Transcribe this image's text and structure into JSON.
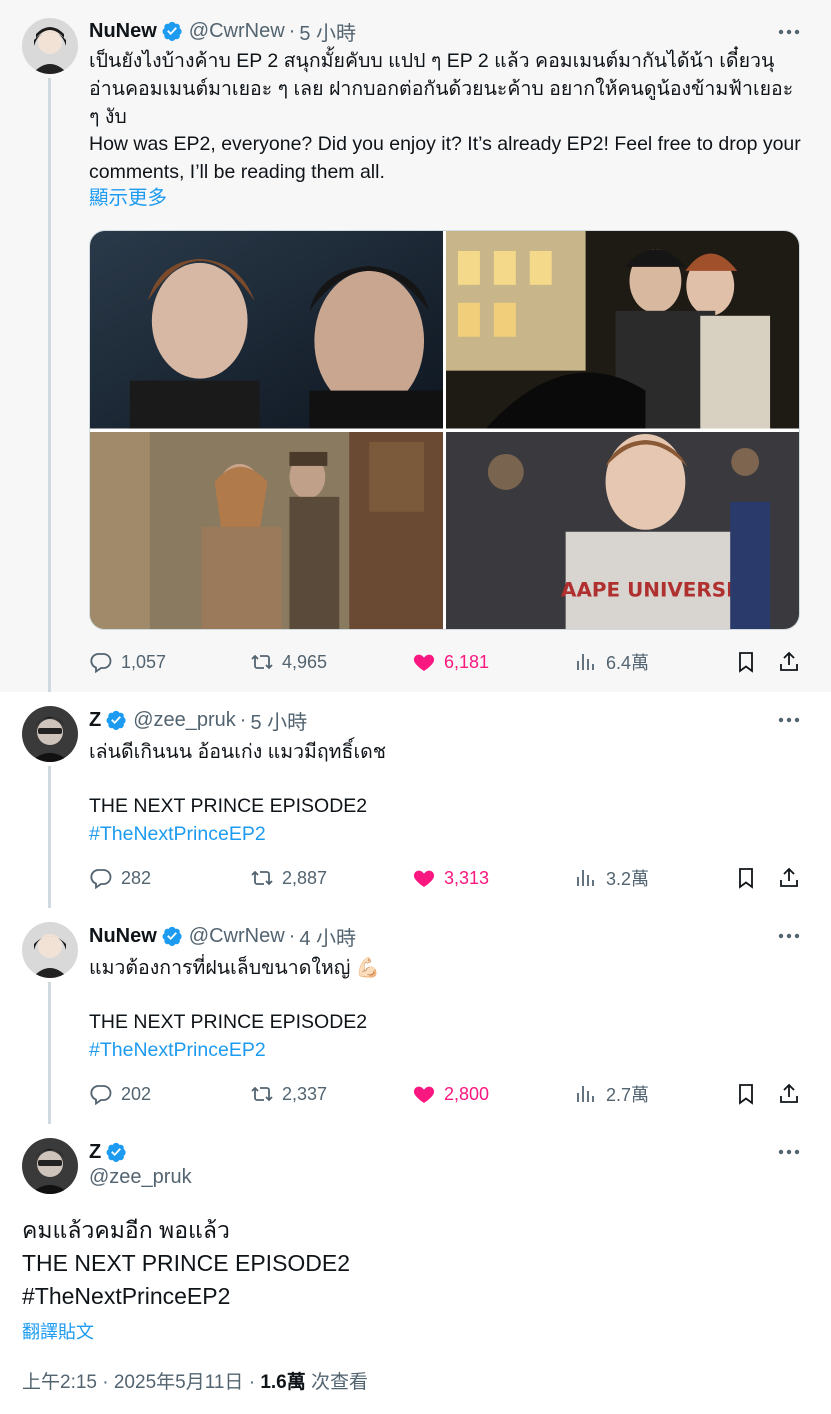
{
  "tweets": [
    {
      "name": "NuNew",
      "handle": "@CwrNew",
      "dot": "·",
      "time": "5 小時",
      "text_th": "เป็นยังไงบ้างค้าบ EP 2 สนุกมั้ยคับบ แปป ๆ EP 2 แล้ว คอมเมนต์มากันได้น้า เดี๋ยวนุอ่านคอมเมนต์มาเยอะ ๆ เลย ฝากบอกต่อกันด้วยนะค้าบ อยากให้คนดูน้องข้ามฟ้าเยอะ ๆ งับ",
      "text_en": "How was EP2, everyone? Did you enjoy it? It’s already EP2! Feel free to drop your comments, I’ll be reading them all.",
      "show_more": "顯示更多",
      "replies": "1,057",
      "retweets": "4,965",
      "likes": "6,181",
      "views": "6.4萬"
    },
    {
      "name": "Z",
      "handle": "@zee_pruk",
      "dot": "·",
      "time": "5 小時",
      "line1": "เล่นดีเกินนน อ้อนเก่ง แมวมีฤทธิ์เดช",
      "line2": "THE NEXT PRINCE EPISODE2",
      "hashtag": "#TheNextPrinceEP2",
      "replies": "282",
      "retweets": "2,887",
      "likes": "3,313",
      "views": "3.2萬"
    },
    {
      "name": "NuNew",
      "handle": "@CwrNew",
      "dot": "·",
      "time": "4 小時",
      "line1": "แมวต้องการที่ฝนเล็บขนาดใหญ่ 💪🏻",
      "line2": "THE NEXT PRINCE EPISODE2",
      "hashtag": "#TheNextPrinceEP2",
      "replies": "202",
      "retweets": "2,337",
      "likes": "2,800",
      "views": "2.7萬"
    }
  ],
  "main": {
    "name": "Z",
    "handle": "@zee_pruk",
    "line1": "คมแล้วคมอีก พอแล้ว",
    "line2": "THE NEXT PRINCE EPISODE2",
    "hashtag": "#TheNextPrinceEP2",
    "translate": "翻譯貼文",
    "timestamp": "上午2:15 · 2025年5月11日",
    "dot": "·",
    "view_count": "1.6萬",
    "view_label": "次查看"
  },
  "colors": {
    "accent": "#1d9bf0",
    "like": "#f91880",
    "secondary": "#536471"
  }
}
